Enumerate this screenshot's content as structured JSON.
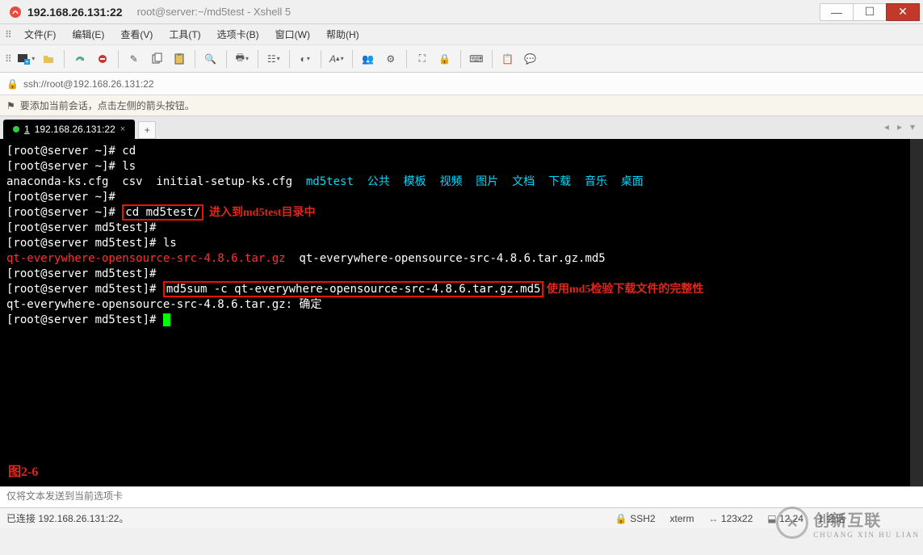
{
  "title": {
    "main": "192.168.26.131:22",
    "sub": "root@server:~/md5test - Xshell 5"
  },
  "menu": [
    "文件(F)",
    "编辑(E)",
    "查看(V)",
    "工具(T)",
    "选项卡(B)",
    "窗口(W)",
    "帮助(H)"
  ],
  "address": "ssh://root@192.168.26.131:22",
  "infotip": "要添加当前会话，点击左侧的箭头按钮。",
  "tab": {
    "num": "1",
    "label": "192.168.26.131:22"
  },
  "term": {
    "l1": "[root@server ~]# cd",
    "l2": "[root@server ~]# ls",
    "l3a": "anaconda-ks.cfg  csv  initial-setup-ks.cfg  ",
    "l3b": "md5test  公共  模板  视频  图片  文档  下载  音乐  桌面",
    "l4": "[root@server ~]#",
    "l5a": "[root@server ~]# ",
    "l5cmd": "cd md5test/",
    "l5ann": "  进入到md5test目录中",
    "l6": "[root@server md5test]#",
    "l7": "[root@server md5test]# ls",
    "l8a": "qt-everywhere-opensource-src-4.8.6.tar.gz",
    "l8b": "  qt-everywhere-opensource-src-4.8.6.tar.gz.md5",
    "l9": "[root@server md5test]#",
    "l10a": "[root@server md5test]# ",
    "l10cmd": "md5sum -c qt-everywhere-opensource-src-4.8.6.tar.gz.md5",
    "l10ann": " 使用md5检验下载文件的完整性",
    "l11": "qt-everywhere-opensource-src-4.8.6.tar.gz: 确定",
    "l12": "[root@server md5test]# ",
    "fig": "图2-6"
  },
  "sendbar_placeholder": "仅将文本发送到当前选项卡",
  "status": {
    "left": "已连接 192.168.26.131:22。",
    "ssh": "SSH2",
    "term": "xterm",
    "size": "123x22",
    "pos": "12,24",
    "sess": "1 会话"
  },
  "watermark": {
    "big": "创新互联",
    "small": "CHUANG XIN HU LIAN"
  }
}
